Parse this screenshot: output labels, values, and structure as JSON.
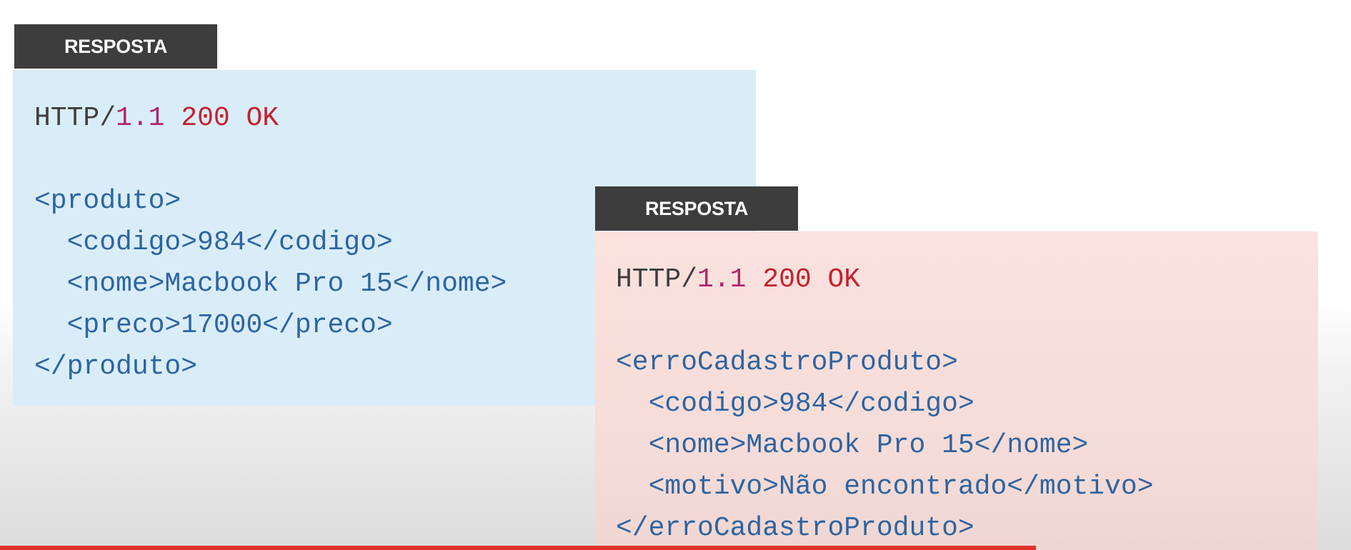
{
  "panel_left": {
    "label": "RESPOSTA",
    "status_line": {
      "protocol": "HTTP/",
      "version": "1.1",
      "status": "200 OK"
    },
    "lines": [
      {
        "indent": "",
        "text": "<produto>"
      },
      {
        "indent": "  ",
        "text": "<codigo>984</codigo>"
      },
      {
        "indent": "  ",
        "text": "<nome>Macbook Pro 15</nome>"
      },
      {
        "indent": "  ",
        "text": "<preco>17000</preco>"
      },
      {
        "indent": "",
        "text": "</produto>"
      }
    ]
  },
  "panel_right": {
    "label": "RESPOSTA",
    "status_line": {
      "protocol": "HTTP/",
      "version": "1.1",
      "status": "200 OK"
    },
    "lines": [
      {
        "indent": "",
        "text": "<erroCadastroProduto>"
      },
      {
        "indent": "  ",
        "text": "<codigo>984</codigo>"
      },
      {
        "indent": "  ",
        "text": "<nome>Macbook Pro 15</nome>"
      },
      {
        "indent": "  ",
        "text": "<motivo>Não encontrado</motivo>"
      },
      {
        "indent": "",
        "text": "</erroCadastroProduto>"
      }
    ]
  },
  "colors": {
    "label_bg": "#3d3d3d",
    "left_panel_bg": "#d9edf9",
    "right_panel_bg": "#fbe2df",
    "version": "#b0266b",
    "status": "#c4222d",
    "tag": "#2e64a0",
    "progress_bar": "#e0322b"
  }
}
